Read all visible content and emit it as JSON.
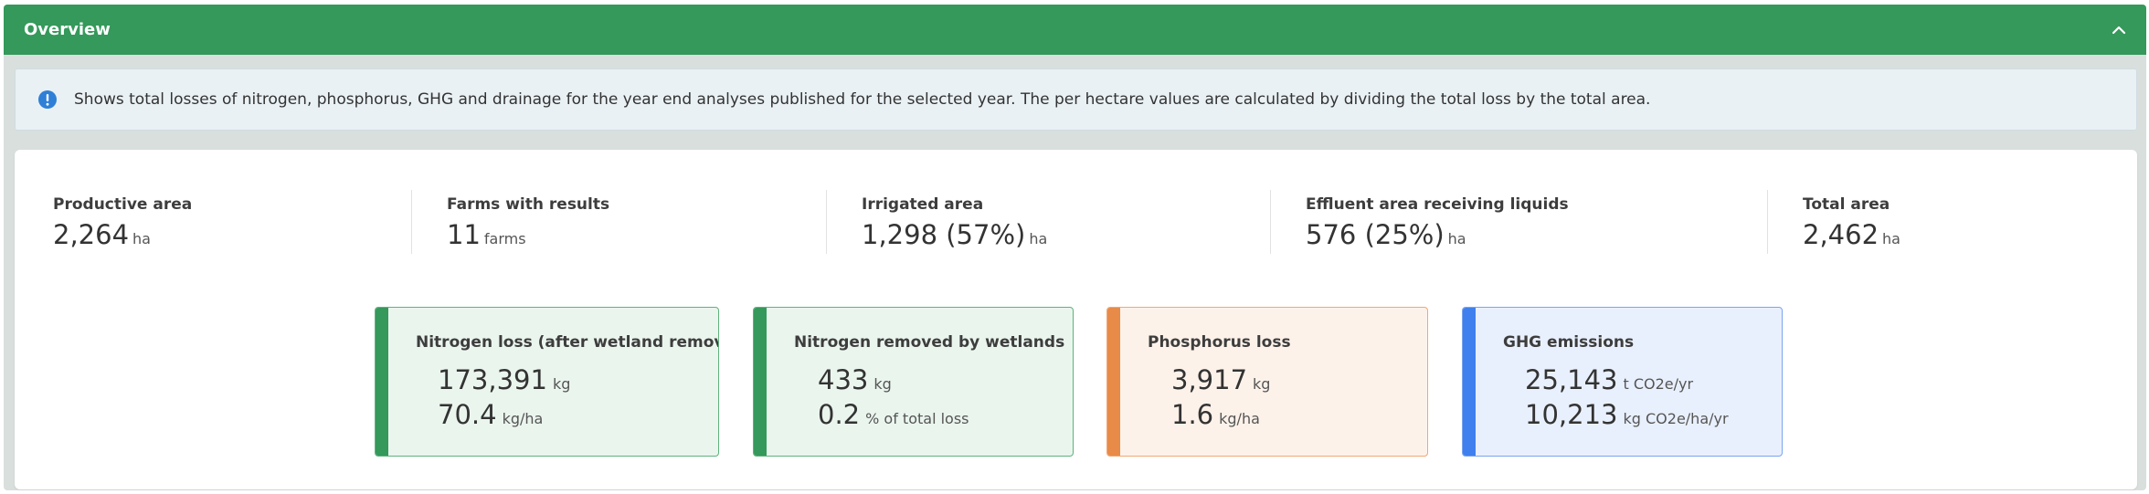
{
  "panel": {
    "title": "Overview",
    "collapse_icon": "chevron-up-icon"
  },
  "info": {
    "icon": "info-icon",
    "text": "Shows total losses of nitrogen, phosphorus, GHG and drainage for the year end analyses published for the selected year. The per hectare values are calculated by dividing the total loss by the total area."
  },
  "stats": [
    {
      "label": "Productive area",
      "value": "2,264",
      "unit": "ha"
    },
    {
      "label": "Farms with results",
      "value": "11",
      "unit": "farms"
    },
    {
      "label": "Irrigated area",
      "value": "1,298 (57%)",
      "unit": "ha"
    },
    {
      "label": "Effluent area receiving liquids",
      "value": "576 (25%)",
      "unit": "ha"
    },
    {
      "label": "Total area",
      "value": "2,462",
      "unit": "ha"
    }
  ],
  "metrics": [
    {
      "title": "Nitrogen loss (after wetland removal)",
      "value1": "173,391",
      "unit1": "kg",
      "value2": "70.4",
      "unit2": "kg/ha",
      "color": "#34995a"
    },
    {
      "title": "Nitrogen removed by wetlands",
      "value1": "433",
      "unit1": "kg",
      "value2": "0.2",
      "unit2": "% of total loss",
      "color": "#34995a"
    },
    {
      "title": "Phosphorus loss",
      "value1": "3,917",
      "unit1": "kg",
      "value2": "1.6",
      "unit2": "kg/ha",
      "color": "#e88a48"
    },
    {
      "title": "GHG emissions",
      "value1": "25,143",
      "unit1": "t CO2e/yr",
      "value2": "10,213",
      "unit2": "kg CO2e/ha/yr",
      "color": "#3f80ee"
    }
  ]
}
